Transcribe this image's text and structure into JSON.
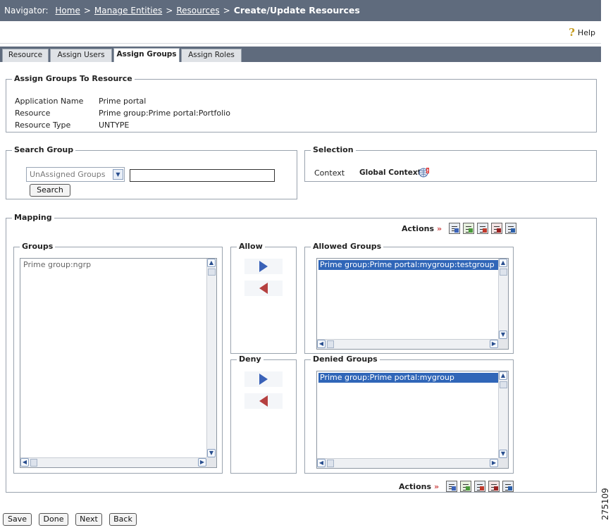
{
  "navigator": {
    "label": "Navigator:",
    "crumbs": [
      "Home",
      "Manage Entities",
      "Resources"
    ],
    "separator": ">",
    "current": "Create/Update Resources"
  },
  "help_label": "Help",
  "tabs": [
    "Resource",
    "Assign Users",
    "Assign Groups",
    "Assign Roles"
  ],
  "active_tab": "Assign Groups",
  "assign_section": {
    "legend": "Assign Groups To Resource",
    "rows": [
      {
        "label": "Application Name",
        "value": "Prime portal"
      },
      {
        "label": "Resource",
        "value": "Prime group:Prime portal:Portfolio"
      },
      {
        "label": "Resource Type",
        "value": "UNTYPE"
      }
    ]
  },
  "search_group": {
    "legend": "Search Group",
    "filter_value": "UnAssigned Groups",
    "query": "",
    "search_button": "Search"
  },
  "selection": {
    "legend": "Selection",
    "context_label": "Context",
    "context_value": "Global Context"
  },
  "mapping": {
    "legend": "Mapping",
    "actions_label": "Actions",
    "actions_chevron": "»",
    "groups": {
      "legend": "Groups",
      "items": [
        "Prime group:ngrp"
      ]
    },
    "allow": {
      "legend": "Allow"
    },
    "deny": {
      "legend": "Deny"
    },
    "allowed_groups": {
      "legend": "Allowed Groups",
      "items": [
        "Prime group:Prime portal:mygroup:testgroup"
      ]
    },
    "denied_groups": {
      "legend": "Denied Groups",
      "items": [
        "Prime group:Prime portal:mygroup"
      ]
    }
  },
  "footer_buttons": [
    "Save",
    "Done",
    "Next",
    "Back"
  ],
  "figure_id": "275109",
  "colors": {
    "nav_bg": "#5f6b7d",
    "selection": "#3066b8",
    "allow_arrow": "#3a62b8",
    "deny_arrow": "#b54040"
  }
}
